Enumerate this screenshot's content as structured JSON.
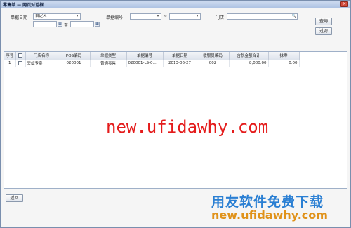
{
  "window": {
    "title": "零售单 — 网页对话框",
    "close_glyph": "×"
  },
  "filters": {
    "date_label": "单据日期",
    "date_mode": "自定义",
    "date_to_label": "至",
    "date_from": "",
    "date_to": "",
    "billno_label": "单据编号",
    "billno_from": "",
    "billno_to": "",
    "billno_sep": "~",
    "store_label": "门店",
    "store_value": "",
    "calendar_icon": "calendar-icon",
    "search_icon": "search-icon",
    "dropdown_glyph": "▾",
    "calendar_glyph": "▦",
    "search_glyph": "🔍"
  },
  "buttons": {
    "query": "查询",
    "filter": "过滤",
    "back": "返回"
  },
  "table": {
    "columns": [
      "序号",
      "",
      "门店名称",
      "POS编码",
      "单据类型",
      "单据编号",
      "单据日期",
      "收银员编码",
      "含税金额合计",
      "抹零"
    ],
    "rows": [
      {
        "no": "1",
        "store": "天虹专卖",
        "pos": "020001",
        "type": "普通零售",
        "billno": "020001-LS-0...",
        "date": "2013-06-27",
        "cashier": "002",
        "amount": "8,000.00",
        "rounding": "0.00"
      }
    ]
  },
  "watermarks": {
    "center": "new.ufidawhy.com",
    "brand": "用友软件免费下载",
    "url": "new.ufidawhy.com"
  },
  "colors": {
    "titlebar": "#aec3e3",
    "watermark_red": "#e41b1b",
    "watermark_blue": "#2a7fd3",
    "watermark_orange": "#e0921a"
  }
}
